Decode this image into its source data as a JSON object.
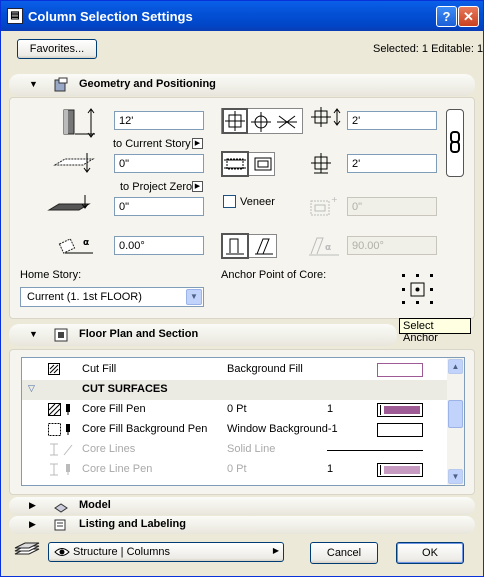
{
  "window": {
    "title": "Column Selection Settings",
    "help_glyph": "?",
    "close_glyph": "✕"
  },
  "header": {
    "favorites_label": "Favorites...",
    "selection_status": "Selected: 1 Editable: 1"
  },
  "geometry": {
    "section_title": "Geometry and Positioning",
    "height_value": "12'",
    "to_current_story_label": "to Current Story",
    "bottom_offset_value": "0\"",
    "to_project_zero_label": "to Project Zero",
    "elevation_value": "0\"",
    "rotation_value": "0.00°",
    "home_story_label": "Home Story:",
    "home_story_value": "Current (1. 1st FLOOR)",
    "width_x_value": "2'",
    "width_y_value": "2'",
    "veneer_label": "Veneer",
    "veneer_thickness_value": "0\"",
    "slant_angle_value": "90.00°",
    "anchor_label": "Anchor Point of Core:",
    "select_anchor_tooltip": "Select Anchor"
  },
  "floor_plan": {
    "section_title": "Floor Plan and Section",
    "rows": [
      {
        "name": "Cut Fill",
        "value": "Background Fill",
        "num": ""
      },
      {
        "name": "CUT SURFACES",
        "value": "",
        "num": ""
      },
      {
        "name": "Core Fill Pen",
        "value": "0 Pt",
        "num": "1"
      },
      {
        "name": "Core Fill Background Pen",
        "value": "Window Background-1",
        "num": ""
      },
      {
        "name": "Core Lines",
        "value": "Solid Line",
        "num": ""
      },
      {
        "name": "Core Line Pen",
        "value": "0 Pt",
        "num": "1"
      }
    ]
  },
  "model": {
    "section_title": "Model"
  },
  "listing": {
    "section_title": "Listing and Labeling"
  },
  "footer": {
    "layer_value": "Structure | Columns",
    "cancel_label": "Cancel",
    "ok_label": "OK"
  },
  "colors": {
    "title_blue": "#0451d6",
    "accent_pen": "#9e5a94",
    "pen_light": "#c79ac1"
  }
}
